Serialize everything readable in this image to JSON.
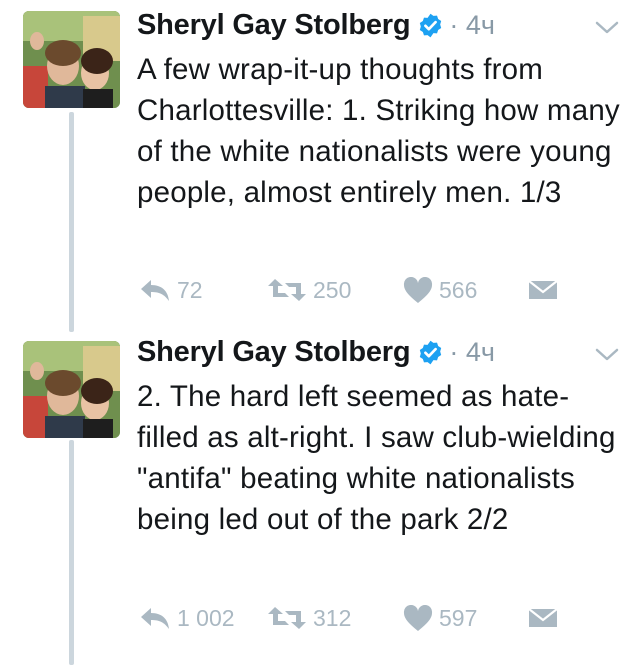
{
  "tweets": [
    {
      "author": "Sheryl Gay Stolberg",
      "time": "· 4ч",
      "text": "A few wrap-it-up thoughts from Charlottesville: 1. Striking how many of the white nationalists were young people, almost entirely men. 1/3",
      "replies": "72",
      "retweets": "250",
      "likes": "566"
    },
    {
      "author": "Sheryl Gay Stolberg",
      "time": "· 4ч",
      "text": "2. The hard left seemed as hate-filled as alt-right. I saw club-wielding \"antifa\" beating white nationalists being led out of the park 2/2",
      "replies": "1 002",
      "retweets": "312",
      "likes": "597"
    }
  ],
  "icons": {
    "verified": "verified-badge-icon",
    "reply": "reply-icon",
    "retweet": "retweet-icon",
    "like": "heart-icon",
    "message": "envelope-icon",
    "caret": "chevron-down-icon"
  },
  "colors": {
    "verified": "#1da1f2",
    "action": "#aab8c2",
    "thread_line": "#ccd6dd",
    "meta": "#8899a6"
  }
}
